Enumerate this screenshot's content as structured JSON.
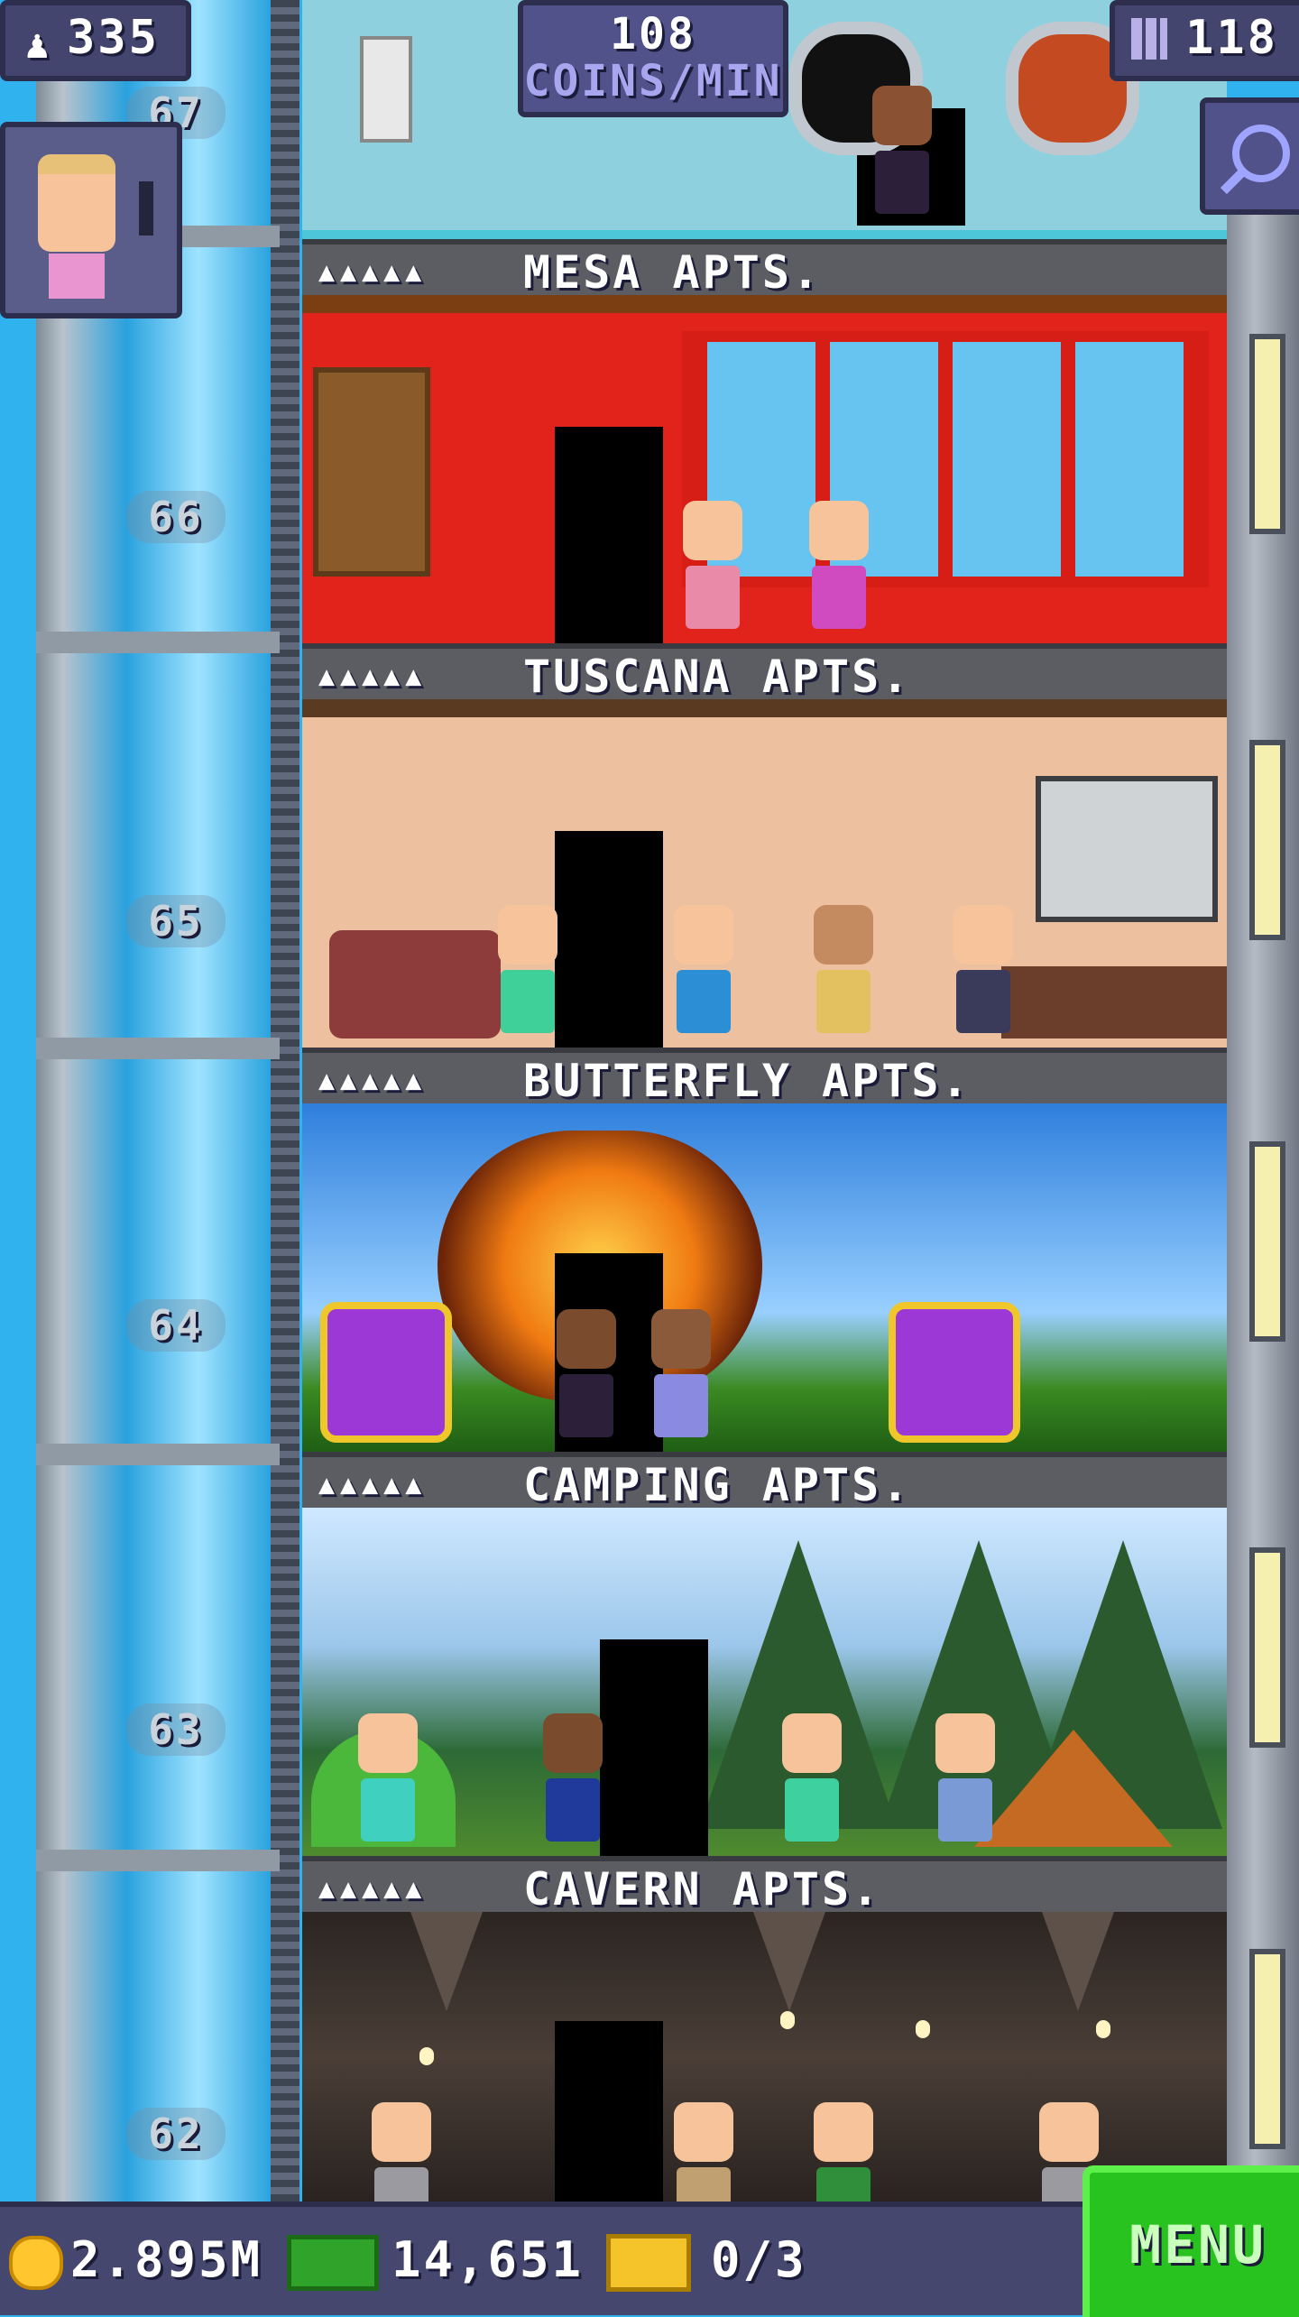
{
  "hud": {
    "population": "335",
    "coins_per_min_value": "108",
    "coins_per_min_unit": "COINS/MIN",
    "floor_count": "118",
    "icons": {
      "population": "person-icon",
      "floors": "building-icon",
      "search": "magnifier-icon"
    }
  },
  "shaft": {
    "floor_labels": [
      "67",
      "66",
      "65",
      "64",
      "63",
      "62"
    ]
  },
  "floors": [
    {
      "id": "mesa",
      "name": "MESA APTS.",
      "stars": "▲▲▲▲▲"
    },
    {
      "id": "tuscana",
      "name": "TUSCANA APTS.",
      "stars": "▲▲▲▲▲"
    },
    {
      "id": "butterfly",
      "name": "BUTTERFLY APTS.",
      "stars": "▲▲▲▲▲"
    },
    {
      "id": "camping",
      "name": "CAMPING APTS.",
      "stars": "▲▲▲▲▲"
    },
    {
      "id": "cavern",
      "name": "CAVERN APTS.",
      "stars": "▲▲▲▲▲"
    }
  ],
  "bottom_bar": {
    "coins": "2.895M",
    "tower_bux": "14,651",
    "tickets": "0/3",
    "menu_label": "MENU"
  },
  "colors": {
    "hud_bg": "#44456e",
    "menu_green": "#29c320",
    "sky": "#2fb2ee"
  }
}
